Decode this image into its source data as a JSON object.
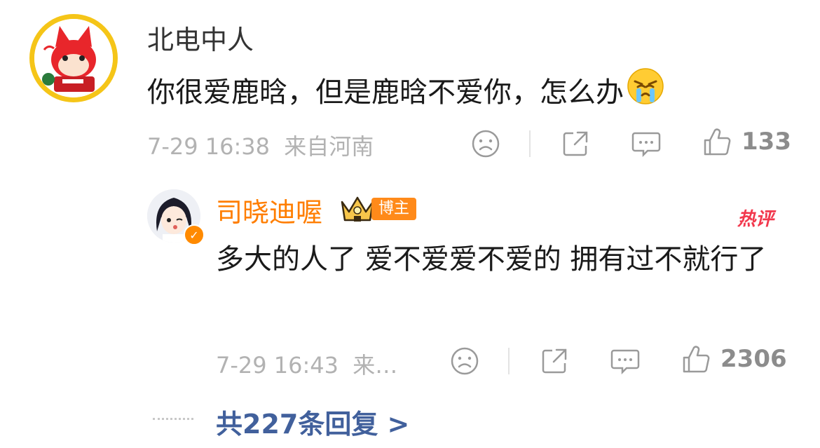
{
  "comment": {
    "username": "北电中人",
    "text": "你很爱鹿晗，但是鹿晗不爱你，怎么办",
    "emoji": "crying-emoji",
    "time": "7-29 16:38",
    "location": "来自河南",
    "like_count": "133"
  },
  "reply": {
    "username": "司晓迪喔",
    "badge": "博主",
    "hot_label": "热评",
    "text": "多大的人了 爱不爱爱不爱的 拥有过不就行了",
    "time": "7-29 16:43",
    "location": "来…",
    "like_count": "2306"
  },
  "more_replies": "共227条回复 >",
  "colors": {
    "username_vip": "#ff7e00",
    "link_blue": "#41609c",
    "meta_gray": "#b2b2b2",
    "hot_red": "#f2384d",
    "badge_orange": "#ff8a1a"
  }
}
